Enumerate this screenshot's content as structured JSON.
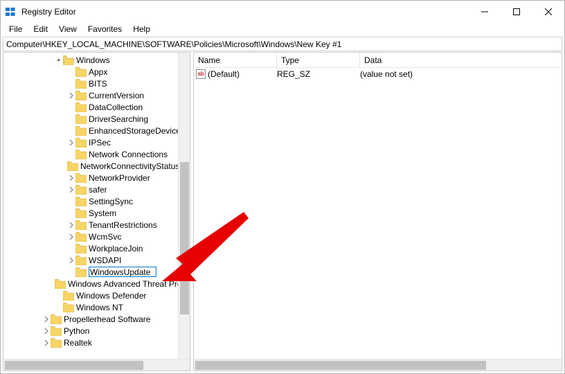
{
  "window": {
    "title": "Registry Editor"
  },
  "menu": {
    "file": "File",
    "edit": "Edit",
    "view": "View",
    "favorites": "Favorites",
    "help": "Help"
  },
  "address": {
    "path": "Computer\\HKEY_LOCAL_MACHINE\\SOFTWARE\\Policies\\Microsoft\\Windows\\New Key #1"
  },
  "columns": {
    "name": "Name",
    "type": "Type",
    "data": "Data"
  },
  "values": [
    {
      "name": "(Default)",
      "type": "REG_SZ",
      "data": "(value not set)",
      "kind": "string"
    }
  ],
  "tree": {
    "root": "Windows",
    "editing_value": "WindowsUpdate",
    "items": [
      {
        "indent": 4,
        "expander": "v",
        "label": "Windows",
        "open": true
      },
      {
        "indent": 5,
        "expander": "",
        "label": "Appx"
      },
      {
        "indent": 5,
        "expander": "",
        "label": "BITS"
      },
      {
        "indent": 5,
        "expander": ">",
        "label": "CurrentVersion"
      },
      {
        "indent": 5,
        "expander": "",
        "label": "DataCollection"
      },
      {
        "indent": 5,
        "expander": "",
        "label": "DriverSearching"
      },
      {
        "indent": 5,
        "expander": "",
        "label": "EnhancedStorageDevices"
      },
      {
        "indent": 5,
        "expander": ">",
        "label": "IPSec"
      },
      {
        "indent": 5,
        "expander": "",
        "label": "Network Connections"
      },
      {
        "indent": 5,
        "expander": "",
        "label": "NetworkConnectivityStatusIndicator"
      },
      {
        "indent": 5,
        "expander": ">",
        "label": "NetworkProvider"
      },
      {
        "indent": 5,
        "expander": ">",
        "label": "safer"
      },
      {
        "indent": 5,
        "expander": "",
        "label": "SettingSync"
      },
      {
        "indent": 5,
        "expander": "",
        "label": "System"
      },
      {
        "indent": 5,
        "expander": ">",
        "label": "TenantRestrictions"
      },
      {
        "indent": 5,
        "expander": ">",
        "label": "WcmSvc"
      },
      {
        "indent": 5,
        "expander": "",
        "label": "WorkplaceJoin"
      },
      {
        "indent": 5,
        "expander": ">",
        "label": "WSDAPI"
      },
      {
        "indent": 5,
        "expander": "",
        "label": "WindowsUpdate",
        "editing": true
      },
      {
        "indent": 4,
        "expander": "",
        "label": "Windows Advanced Threat Protection"
      },
      {
        "indent": 4,
        "expander": "",
        "label": "Windows Defender"
      },
      {
        "indent": 4,
        "expander": "",
        "label": "Windows NT"
      },
      {
        "indent": 3,
        "expander": ">",
        "label": "Propellerhead Software"
      },
      {
        "indent": 3,
        "expander": ">",
        "label": "Python"
      },
      {
        "indent": 3,
        "expander": ">",
        "label": "Realtek"
      }
    ]
  }
}
